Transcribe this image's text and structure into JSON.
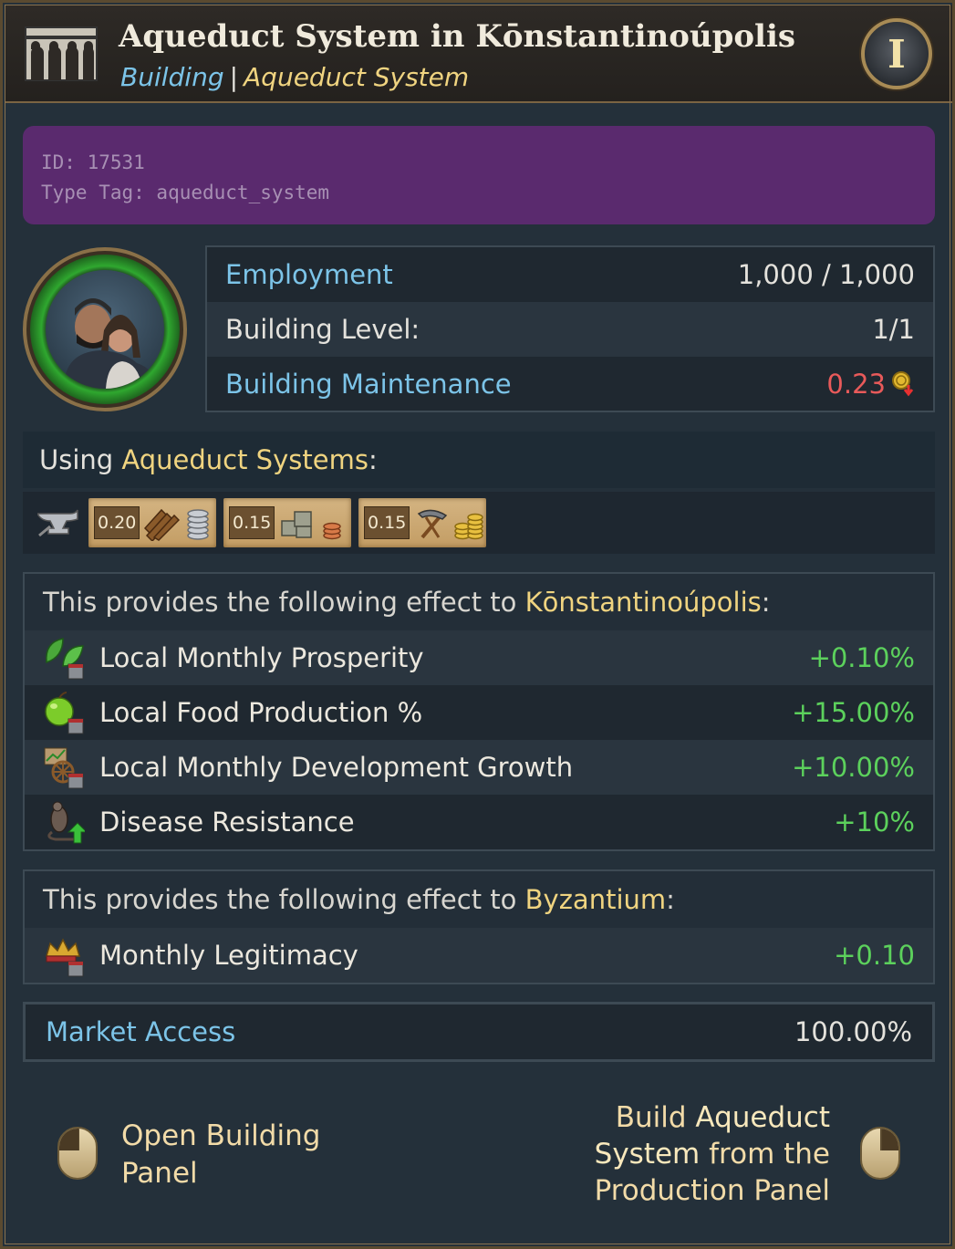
{
  "header": {
    "title": "Aqueduct System in Kōnstantinoúpolis",
    "category": "Building",
    "separator": "|",
    "type": "Aqueduct System",
    "info_letter": "I"
  },
  "debug": {
    "id_line": "ID: 17531",
    "tag_line": "Type Tag: aqueduct_system"
  },
  "stats": [
    {
      "label": "Employment",
      "value": "1,000 / 1,000"
    },
    {
      "label": "Building Level:",
      "value": "1/1"
    },
    {
      "label": "Building Maintenance",
      "value": "0.23"
    }
  ],
  "using": {
    "prefix": "Using ",
    "name": "Aqueduct Systems",
    "suffix": ":",
    "goods": [
      {
        "value": "0.20"
      },
      {
        "value": "0.15"
      },
      {
        "value": "0.15"
      }
    ]
  },
  "local_effects": {
    "prefix": "This provides the following effect to ",
    "target": "Kōnstantinoúpolis",
    "suffix": ":",
    "rows": [
      {
        "label": "Local Monthly Prosperity",
        "value": "+0.10%",
        "icon": "leaf-icon"
      },
      {
        "label": "Local Food Production %",
        "value": "+15.00%",
        "icon": "apple-icon"
      },
      {
        "label": "Local Monthly Development Growth",
        "value": "+10.00%",
        "icon": "development-icon"
      },
      {
        "label": "Disease Resistance",
        "value": "+10%",
        "icon": "rat-icon"
      }
    ]
  },
  "country_effects": {
    "prefix": "This provides the following effect to ",
    "target": "Byzantium",
    "suffix": ":",
    "rows": [
      {
        "label": "Monthly Legitimacy",
        "value": "+0.10",
        "icon": "crown-icon"
      }
    ]
  },
  "market": {
    "label": "Market Access",
    "value": "100.00%"
  },
  "actions": {
    "left": {
      "line1": "Open Building",
      "line2": "Panel"
    },
    "right": {
      "line1": "Build ",
      "line1_hl": "Aqueduct",
      "line2_hl": "System",
      "line2": " from the",
      "line3": "Production Panel"
    }
  },
  "colors": {
    "positive": "#5cd15c",
    "negative": "#e85a5a",
    "link": "#7cc4e8",
    "highlight": "#f0d480",
    "debug_bg": "#5a2a6e"
  }
}
